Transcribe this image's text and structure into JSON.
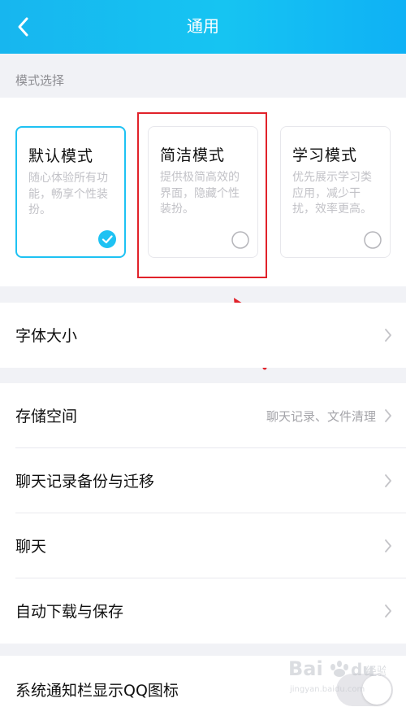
{
  "header": {
    "title": "通用",
    "back_icon": "chevron-left-icon"
  },
  "mode_section": {
    "label": "模式选择",
    "modes": [
      {
        "title": "默认模式",
        "desc": "随心体验所有功能，畅享个性装扮。",
        "selected": true
      },
      {
        "title": "简洁模式",
        "desc": "提供极简高效的界面，隐藏个性装扮。",
        "selected": false
      },
      {
        "title": "学习模式",
        "desc": "优先展示学习类应用，减少干扰，效率更高。",
        "selected": false
      }
    ]
  },
  "settings": {
    "font_size": {
      "label": "字体大小"
    },
    "storage": {
      "label": "存储空间",
      "value": "聊天记录、文件清理"
    },
    "chat_backup": {
      "label": "聊天记录备份与迁移"
    },
    "chat": {
      "label": "聊天"
    },
    "auto_download": {
      "label": "自动下载与保存"
    },
    "notification_icon": {
      "label": "系统通知栏显示QQ图标",
      "toggle_on": false
    }
  },
  "watermark": {
    "brand": "Bai",
    "brand2": "du",
    "suffix": "经验",
    "url": "jingyan.baidu.com"
  },
  "colors": {
    "header": "#17b6ef",
    "selected_border": "#1ec2f3",
    "annotation": "#e1222a"
  }
}
